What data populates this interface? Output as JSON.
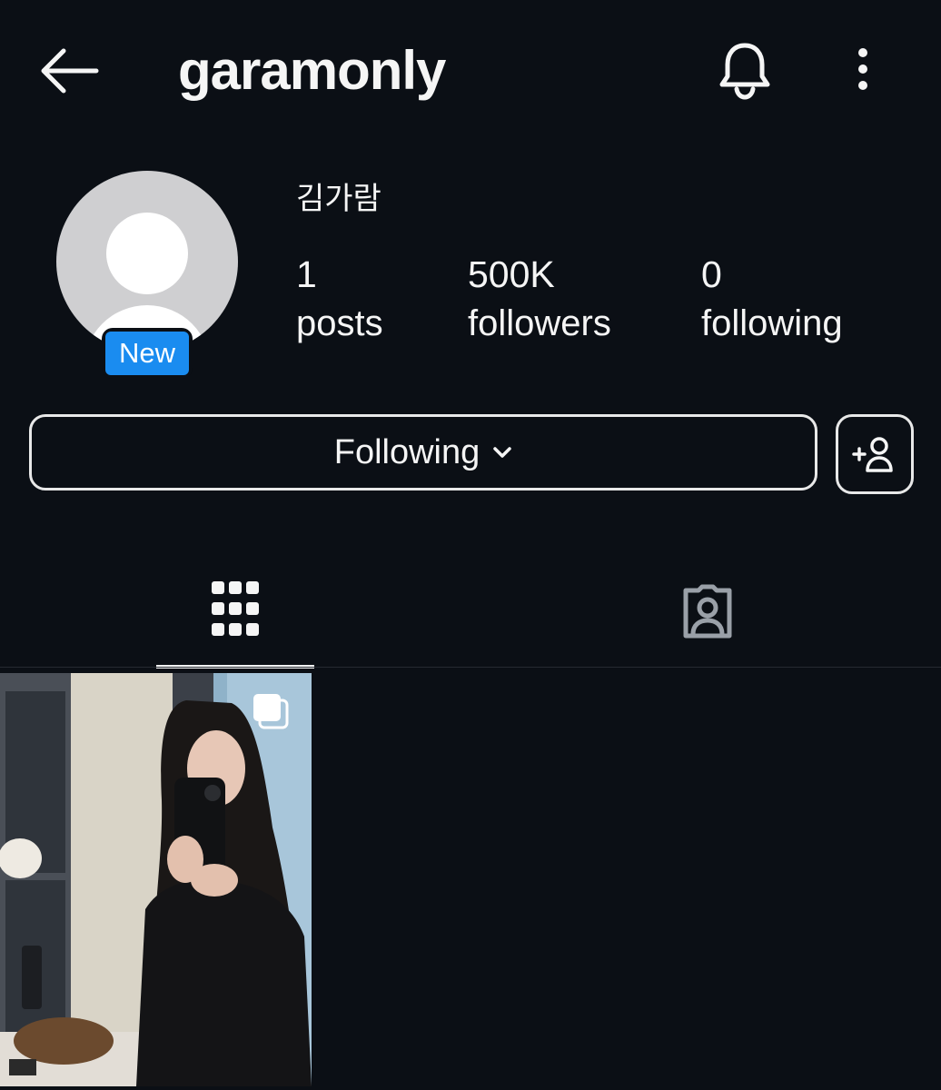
{
  "header": {
    "username": "garamonly"
  },
  "profile": {
    "display_name": "김가람",
    "badge_label": "New",
    "stats": [
      {
        "value": "1",
        "label": "posts"
      },
      {
        "value": "500K",
        "label": "followers"
      },
      {
        "value": "0",
        "label": "following"
      }
    ]
  },
  "actions": {
    "following_label": "Following"
  },
  "tabs": [
    {
      "icon": "grid-icon",
      "active": true
    },
    {
      "icon": "tagged-icon",
      "active": false
    }
  ],
  "posts": [
    {
      "type": "carousel",
      "icon": "multiple-images-icon"
    }
  ],
  "colors": {
    "background": "#0b0f15",
    "badge_blue": "#1a8cf0",
    "text": "#f5f5f5"
  }
}
